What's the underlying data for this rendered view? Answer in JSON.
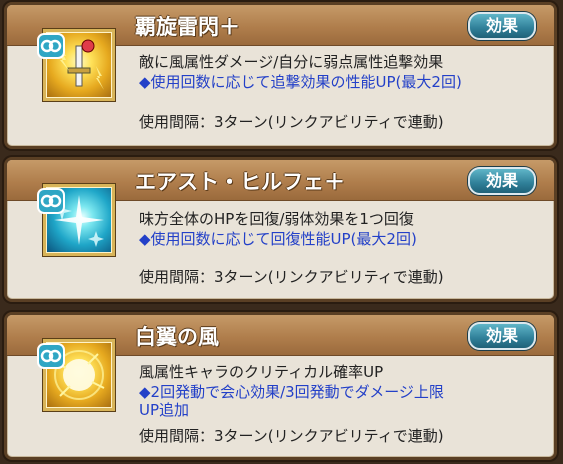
{
  "skills": [
    {
      "name": "覇旋雷閃＋",
      "effect_label": "効果",
      "icon": "sword-lightning-icon",
      "line1": "敵に風属性ダメージ/自分に弱点属性追撃効果",
      "line2": "◆使用回数に応じて追撃効果の性能UP(最大2回)",
      "line3": "使用間隔：3ターン(リンクアビリティで連動)"
    },
    {
      "name": "エアスト・ヒルフェ＋",
      "effect_label": "効果",
      "icon": "sparkle-heal-icon",
      "line1": "味方全体のHPを回復/弱体効果を1つ回復",
      "line2": "◆使用回数に応じて回復性能UP(最大2回)",
      "line3": "使用間隔：3ターン(リンクアビリティで連動)"
    },
    {
      "name": "白翼の風",
      "effect_label": "効果",
      "icon": "light-orb-icon",
      "line1": "風属性キャラのクリティカル確率UP",
      "line2": "◆2回発動で会心効果/3回発動でダメージ上限",
      "line2b": "UP追加",
      "line3": "使用間隔：3ターン(リンクアビリティで連動)"
    }
  ],
  "colors": {
    "header": "#b07e4c",
    "button": "#2f7f98",
    "body_bg": "#e9e3d8",
    "blue_text": "#2340c8"
  }
}
